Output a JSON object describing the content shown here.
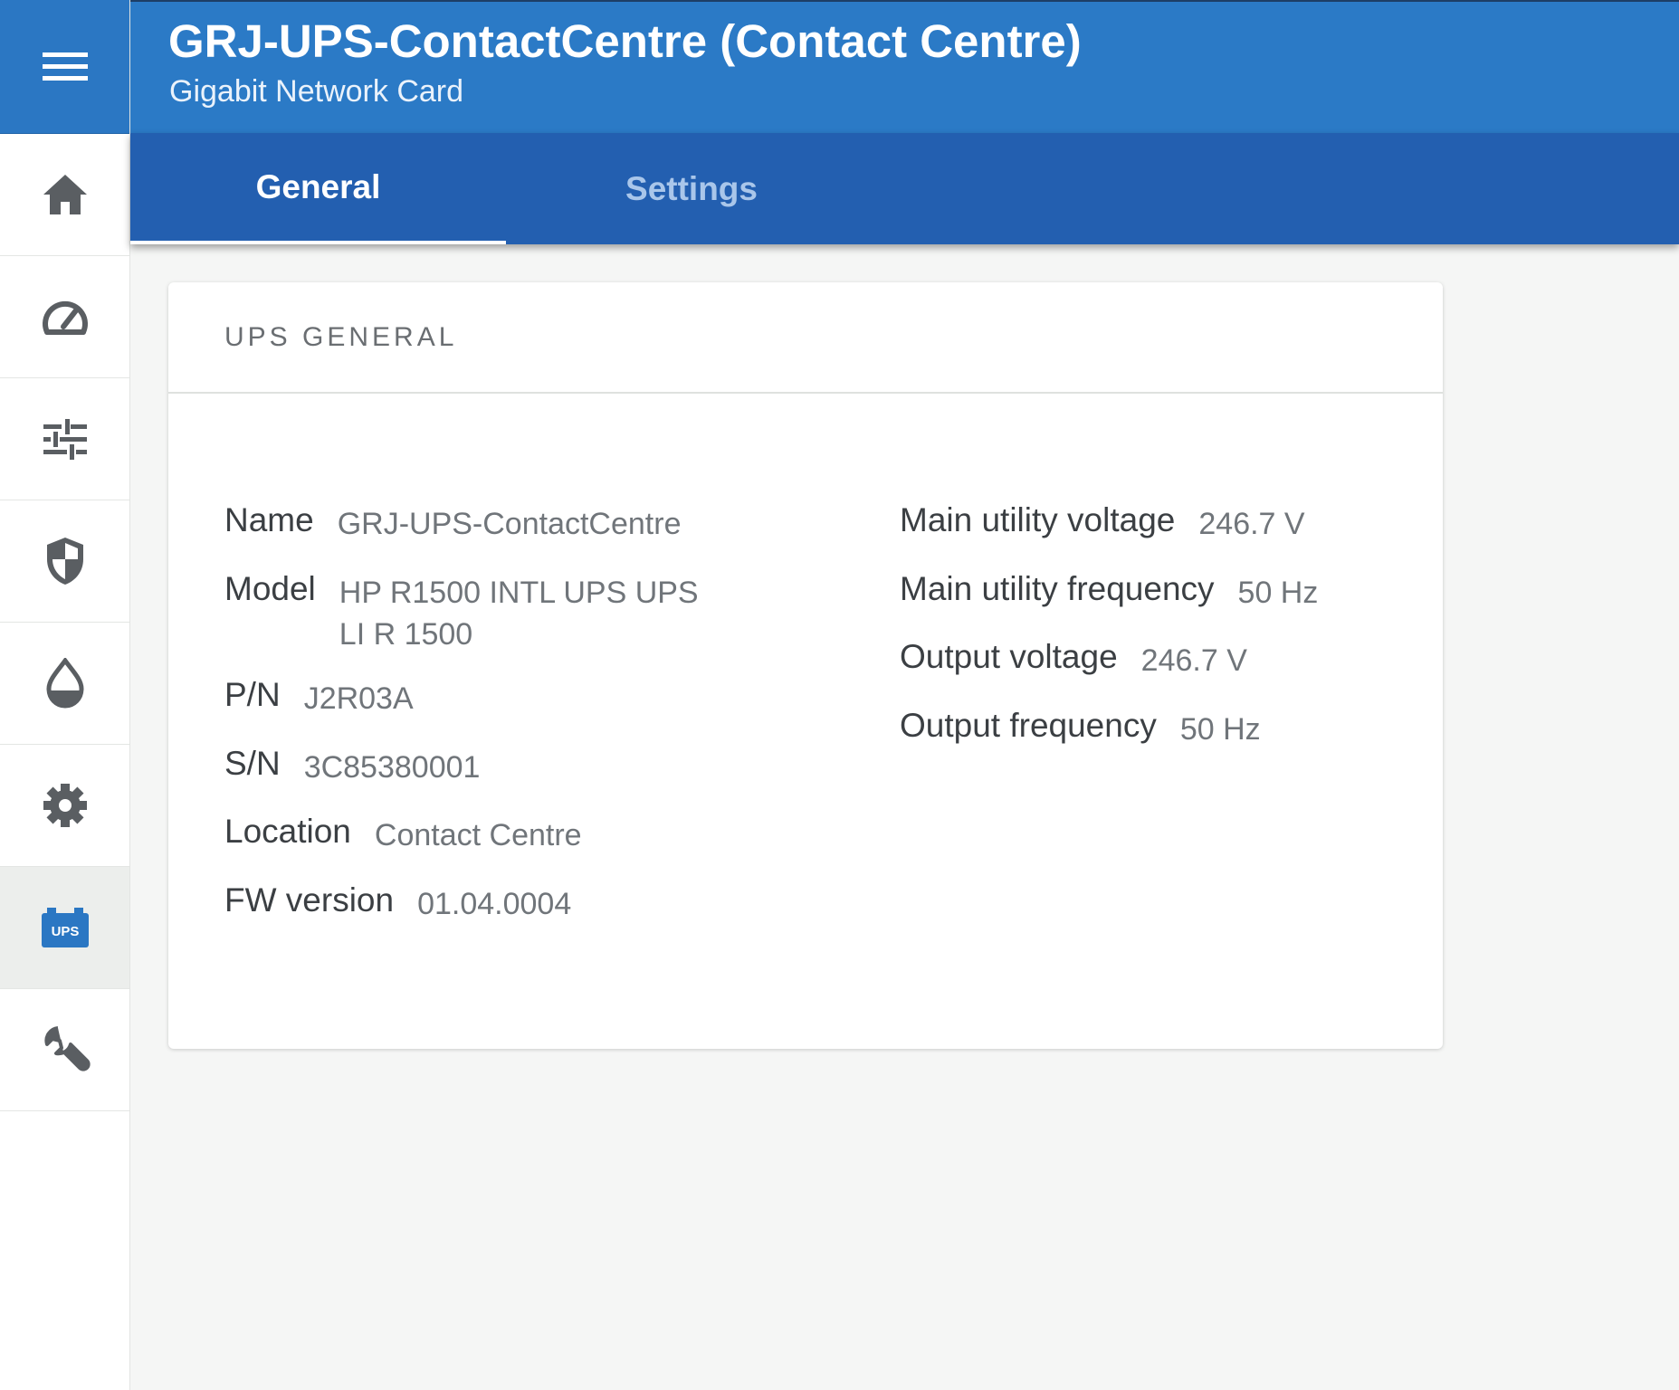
{
  "header": {
    "title": "GRJ-UPS-ContactCentre (Contact Centre)",
    "subtitle": "Gigabit Network Card"
  },
  "sidebar": {
    "items": [
      {
        "id": "home",
        "icon": "home-icon"
      },
      {
        "id": "dashboard",
        "icon": "speedometer-icon"
      },
      {
        "id": "controls",
        "icon": "sliders-icon"
      },
      {
        "id": "security",
        "icon": "shield-icon"
      },
      {
        "id": "environment",
        "icon": "water-drop-icon"
      },
      {
        "id": "settings",
        "icon": "gear-icon"
      },
      {
        "id": "ups",
        "icon": "ups-battery-icon",
        "badge": "UPS",
        "active": true
      },
      {
        "id": "maintenance",
        "icon": "wrench-icon"
      }
    ]
  },
  "tabs": [
    {
      "label": "General",
      "active": true
    },
    {
      "label": "Settings",
      "active": false
    }
  ],
  "card": {
    "title": "UPS GENERAL",
    "left_fields": [
      {
        "label": "Name",
        "value": "GRJ-UPS-ContactCentre"
      },
      {
        "label": "Model",
        "value": "HP R1500 INTL UPS UPS LI R 1500"
      },
      {
        "label": "P/N",
        "value": "J2R03A"
      },
      {
        "label": "S/N",
        "value": "3C85380001"
      },
      {
        "label": "Location",
        "value": "Contact Centre"
      },
      {
        "label": "FW version",
        "value": "01.04.0004"
      }
    ],
    "right_fields": [
      {
        "label": "Main utility voltage",
        "value": "246.7 V"
      },
      {
        "label": "Main utility frequency",
        "value": "50 Hz"
      },
      {
        "label": "Output voltage",
        "value": "246.7 V"
      },
      {
        "label": "Output frequency",
        "value": "50 Hz"
      }
    ]
  },
  "colors": {
    "header_blue": "#2b7ac6",
    "tabbar_blue": "#235fb0",
    "icon_gray": "#5a5e62",
    "active_icon_blue": "#2b77c3"
  }
}
